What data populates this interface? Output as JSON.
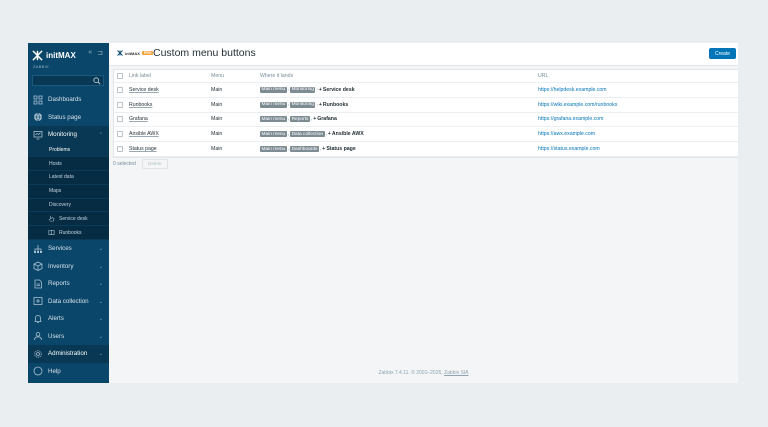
{
  "sidebar": {
    "logo_text": "initMAX",
    "brand_caption": "ZABBIX",
    "menu": [
      {
        "label": "Dashboards",
        "icon": "dashboard-icon"
      },
      {
        "label": "Status page",
        "icon": "globe-icon"
      },
      {
        "label": "Monitoring",
        "icon": "monitor-icon",
        "expanded": true
      }
    ],
    "submenu": [
      {
        "label": "Problems",
        "selected": true
      },
      {
        "label": "Hosts"
      },
      {
        "label": "Latest data"
      },
      {
        "label": "Maps"
      },
      {
        "label": "Discovery"
      },
      {
        "label": "Service desk",
        "icon": "hand-icon"
      },
      {
        "label": "Runbooks",
        "icon": "book-icon"
      }
    ],
    "menu_after": [
      {
        "label": "Services",
        "icon": "services-icon"
      },
      {
        "label": "Inventory",
        "icon": "inventory-icon"
      },
      {
        "label": "Reports",
        "icon": "reports-icon"
      },
      {
        "label": "Data collection",
        "icon": "data-collection-icon"
      },
      {
        "label": "Alerts",
        "icon": "bell-icon"
      },
      {
        "label": "Users",
        "icon": "users-icon"
      },
      {
        "label": "Administration",
        "icon": "gear-icon"
      },
      {
        "label": "Help",
        "icon": "help-icon"
      }
    ]
  },
  "header": {
    "module_logo_text": "initMAX",
    "module_badge": "PRO",
    "title": "Custom menu buttons",
    "create_label": "Create"
  },
  "table": {
    "columns": {
      "label": "Link label",
      "menu": "Menu",
      "where": "Where it lands",
      "url": "URL"
    },
    "rows": [
      {
        "label": "Service desk",
        "menu": "Main",
        "path": [
          "Main menu",
          "Monitoring"
        ],
        "target": "Service desk",
        "url": "https://helpdesk.example.com"
      },
      {
        "label": "Runbooks",
        "menu": "Main",
        "path": [
          "Main menu",
          "Monitoring"
        ],
        "target": "Runbooks",
        "url": "https://wiki.example.com/runbooks"
      },
      {
        "label": "Grafana",
        "menu": "Main",
        "path": [
          "Main menu",
          "Reports"
        ],
        "target": "Grafana",
        "url": "https://grafana.example.com"
      },
      {
        "label": "Ansible AWX",
        "menu": "Main",
        "path": [
          "Main menu",
          "Data collection"
        ],
        "target": "Ansible AWX",
        "url": "https://awx.example.com"
      },
      {
        "label": "Status page",
        "menu": "Main",
        "path": [
          "Main menu",
          "Dashboards"
        ],
        "target": "Status page",
        "url": "https://status.example.com"
      }
    ]
  },
  "footer": {
    "selected_text": "0 selected",
    "delete_label": "Delete",
    "copyright_text": "Zabbix 7.4.11. © 2001–2026, ",
    "copyright_link": "Zabbix SIA"
  },
  "glyphs": {
    "separator": "›",
    "plus": "+",
    "chevron": "⌄"
  }
}
